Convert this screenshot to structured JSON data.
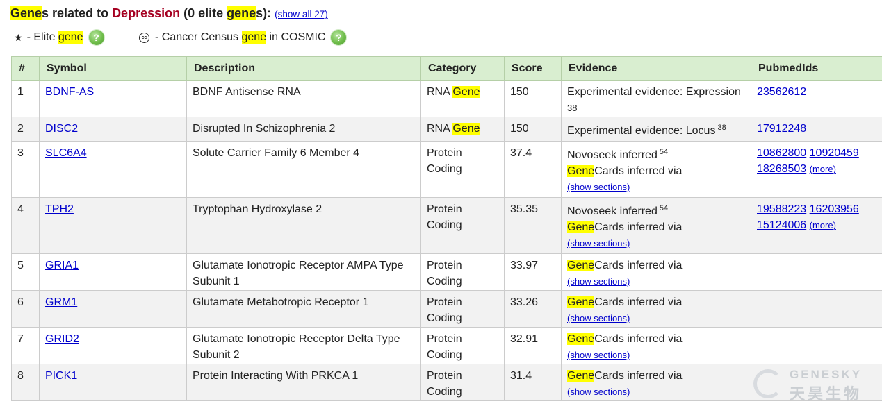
{
  "heading": {
    "prefix_gene": "Gene",
    "prefix_rest": "s related to ",
    "disease": "Depression",
    "count_open": " (0 elite ",
    "count_gene": "gene",
    "count_close": "s):",
    "show_all": "(show all 27)"
  },
  "legend": {
    "elite_text": " - Elite ",
    "elite_gene": "gene",
    "cancer_text": " - Cancer Census ",
    "cancer_gene": "gene",
    "cancer_suffix": " in COSMIC",
    "help_glyph": "?",
    "star_icon": "★",
    "cc_icon": "cc"
  },
  "table": {
    "headers": [
      "#",
      "Symbol",
      "Description",
      "Category",
      "Score",
      "Evidence",
      "PubmedIds"
    ],
    "rows": [
      {
        "num": "1",
        "symbol": "BDNF-AS",
        "desc": "BDNF Antisense RNA",
        "cat_a": "RNA ",
        "cat_gene": "Gene",
        "score": "150",
        "ev1": "Experimental evidence: Expression",
        "ev1_sup": "",
        "ev2": "38",
        "pub_line1": [
          "23562612"
        ],
        "pub_line2": [],
        "more": ""
      },
      {
        "num": "2",
        "symbol": "DISC2",
        "desc": "Disrupted In Schizophrenia 2",
        "cat_a": "RNA ",
        "cat_gene": "Gene",
        "score": "150",
        "ev1": "Experimental evidence: Locus",
        "ev1_sup": "38",
        "ev2": "",
        "pub_line1": [
          "17912248"
        ],
        "pub_line2": [],
        "more": ""
      },
      {
        "num": "3",
        "symbol": "SLC6A4",
        "desc": "Solute Carrier Family 6 Member 4",
        "cat_a": "Protein Coding",
        "cat_gene": "",
        "score": "37.4",
        "ev_novoseek": "Novoseek inferred",
        "ev_novoseek_sup": "54",
        "ev_gc_gene": "Gene",
        "ev_gc_rest": "Cards inferred via",
        "ev_show": "(show sections)",
        "pub_line1": [
          "10862800",
          "10920459"
        ],
        "pub_line2": [
          "18268503"
        ],
        "more": "(more)"
      },
      {
        "num": "4",
        "symbol": "TPH2",
        "desc": "Tryptophan Hydroxylase 2",
        "cat_a": "Protein Coding",
        "cat_gene": "",
        "score": "35.35",
        "ev_novoseek": "Novoseek inferred",
        "ev_novoseek_sup": "54",
        "ev_gc_gene": "Gene",
        "ev_gc_rest": "Cards inferred via",
        "ev_show": "(show sections)",
        "pub_line1": [
          "19588223",
          "16203956"
        ],
        "pub_line2": [
          "15124006"
        ],
        "more": "(more)"
      },
      {
        "num": "5",
        "symbol": "GRIA1",
        "desc": "Glutamate Ionotropic Receptor AMPA Type Subunit 1",
        "cat_a": "Protein Coding",
        "cat_gene": "",
        "score": "33.97",
        "ev_gc_gene": "Gene",
        "ev_gc_rest": "Cards inferred via",
        "ev_show": "(show sections)"
      },
      {
        "num": "6",
        "symbol": "GRM1",
        "desc": "Glutamate Metabotropic Receptor 1",
        "cat_a": "Protein Coding",
        "cat_gene": "",
        "score": "33.26",
        "ev_gc_gene": "Gene",
        "ev_gc_rest": "Cards inferred via",
        "ev_show": "(show sections)"
      },
      {
        "num": "7",
        "symbol": "GRID2",
        "desc": "Glutamate Ionotropic Receptor Delta Type Subunit 2",
        "cat_a": "Protein Coding",
        "cat_gene": "",
        "score": "32.91",
        "ev_gc_gene": "Gene",
        "ev_gc_rest": "Cards inferred via",
        "ev_show": "(show sections)"
      },
      {
        "num": "8",
        "symbol": "PICK1",
        "desc": "Protein Interacting With PRKCA 1",
        "cat_a": "Protein Coding",
        "cat_gene": "",
        "score": "31.4",
        "ev_gc_gene": "Gene",
        "ev_gc_rest": "Cards inferred via",
        "ev_show": "(show sections)"
      }
    ]
  },
  "watermark": {
    "en": "GENESKY",
    "zh": "天昊生物"
  },
  "colors": {
    "header_bg": "#d9eed0",
    "highlight": "#ffff00",
    "disease": "#a50021",
    "link": "#0000cc",
    "help": "#6fbd4a"
  }
}
